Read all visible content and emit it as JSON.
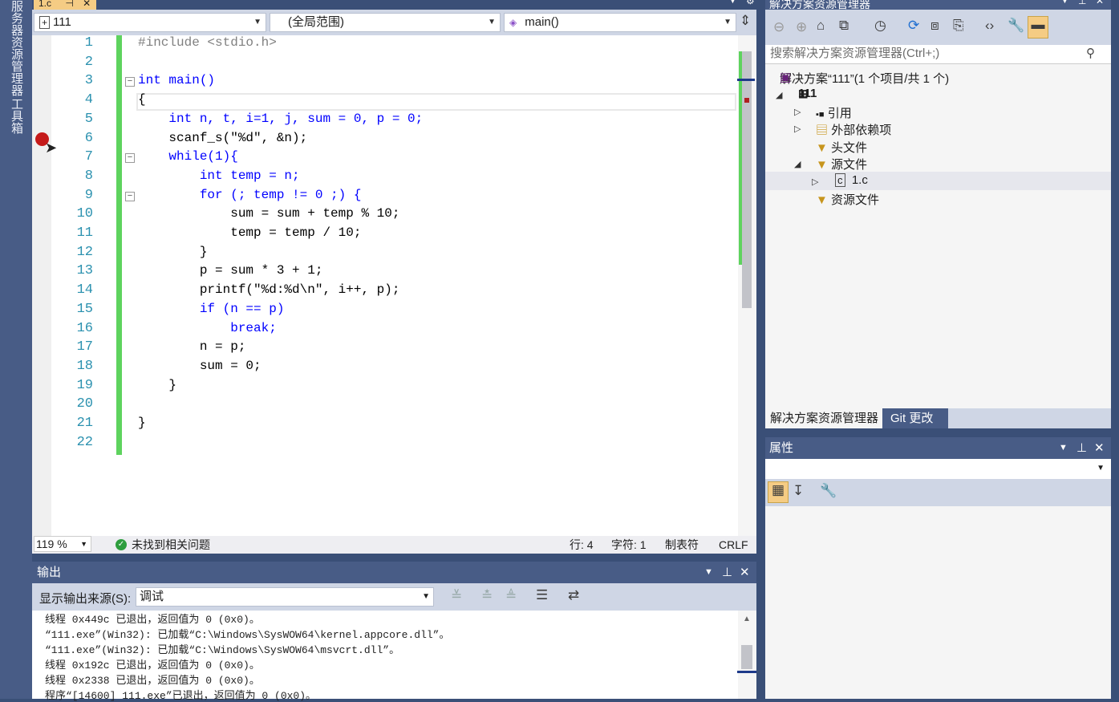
{
  "left_strip": {
    "tab1": "服务器资源管理器",
    "tab2": "工具箱"
  },
  "doc_tab": {
    "label": "1.c"
  },
  "nav": {
    "project": "111",
    "scope": "(全局范围)",
    "member": "main()"
  },
  "code_lines": [
    "#include <stdio.h>",
    "",
    "int main()",
    "{",
    "    int n, t, i=1, j, sum = 0, p = 0;",
    "    scanf_s(\"%d\", &n);",
    "    while(1){",
    "        int temp = n;",
    "        for (; temp != 0 ;) {",
    "            sum = sum + temp % 10;",
    "            temp = temp / 10;",
    "        }",
    "        p = sum * 3 + 1;",
    "        printf(\"%d:%d\\n\", i++, p);",
    "        if (n == p)",
    "            break;",
    "        n = p;",
    "        sum = 0;",
    "    }",
    "",
    "}",
    ""
  ],
  "line_numbers": [
    "1",
    "2",
    "3",
    "4",
    "5",
    "6",
    "7",
    "8",
    "9",
    "10",
    "11",
    "12",
    "13",
    "14",
    "15",
    "16",
    "17",
    "18",
    "19",
    "20",
    "21",
    "22"
  ],
  "status": {
    "zoom": "119 %",
    "issues": "未找到相关问题",
    "line": "行: 4",
    "char": "字符: 1",
    "tab": "制表符",
    "eol": "CRLF"
  },
  "output": {
    "title": "输出",
    "source_label": "显示输出来源(S):",
    "source_value": "调试",
    "lines": [
      "线程 0x449c 已退出，返回值为 0 (0x0)。",
      "“111.exe”(Win32): 已加载“C:\\Windows\\SysWOW64\\kernel.appcore.dll”。",
      "“111.exe”(Win32): 已加载“C:\\Windows\\SysWOW64\\msvcrt.dll”。",
      "线程 0x192c 已退出，返回值为 0 (0x0)。",
      "线程 0x2338 已退出，返回值为 0 (0x0)。",
      "程序“[14600] 111.exe”已退出，返回值为 0 (0x0)。"
    ]
  },
  "solution_explorer": {
    "title": "解决方案资源管理器",
    "search_placeholder": "搜索解决方案资源管理器(Ctrl+;)",
    "solution": "解决方案“111”(1 个项目/共 1 个)",
    "project": "111",
    "items": {
      "refs": "引用",
      "ext": "外部依赖项",
      "headers": "头文件",
      "sources": "源文件",
      "file": "1.c",
      "resources": "资源文件"
    },
    "tab_active": "解决方案资源管理器",
    "tab_git": "Git 更改"
  },
  "properties": {
    "title": "属性"
  },
  "colors": {
    "accent": "#485c86",
    "toolbar": "#cfd6e5",
    "keyword": "#0000ff",
    "string": "#a31515",
    "line_number": "#2b91af",
    "change_bar": "#5ed35e"
  }
}
